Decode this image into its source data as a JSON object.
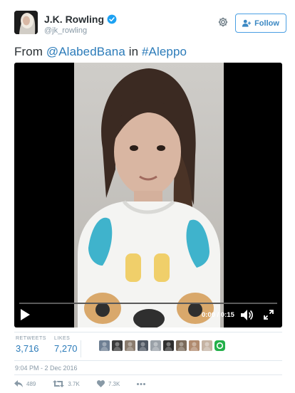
{
  "tweet": {
    "author_name": "J.K. Rowling",
    "author_handle": "@jk_rowling",
    "follow_label": "Follow",
    "text_prefix": "From ",
    "mention": "@AlabedBana",
    "text_middle": " in ",
    "hashtag": "#Aleppo",
    "timestamp": "9:04 PM - 2 Dec 2016"
  },
  "video": {
    "time_display": "0:00 / 0:15",
    "progress_fraction": 0
  },
  "stats": {
    "retweets_label": "RETWEETS",
    "retweets_value": "3,716",
    "likes_label": "LIKES",
    "likes_value": "7,270"
  },
  "liker_avatars": [
    {
      "color": "#6e7f93"
    },
    {
      "color": "#3a3a3a"
    },
    {
      "color": "#8a7b6d"
    },
    {
      "color": "#4d5560"
    },
    {
      "color": "#9aa1a8"
    },
    {
      "color": "#2f2f2f"
    },
    {
      "color": "#7a6a5a"
    },
    {
      "color": "#b08a6e"
    },
    {
      "color": "#c5b3a3"
    },
    {
      "color": "#24b04a"
    }
  ],
  "actions": {
    "reply_count": "489",
    "retweet_count": "3.7K",
    "like_count": "7.3K"
  },
  "colors": {
    "link": "#2b7bb9",
    "muted": "#8899a6",
    "follow_border": "#4a9fe3",
    "verified": "#1da1f2"
  },
  "icons": {
    "gear": "gear-icon",
    "verified": "verified-badge-icon",
    "follow": "follow-person-icon",
    "play": "play-icon",
    "volume": "volume-icon",
    "fullscreen": "fullscreen-icon",
    "reply": "reply-icon",
    "retweet": "retweet-icon",
    "like": "heart-icon",
    "more": "more-icon"
  }
}
